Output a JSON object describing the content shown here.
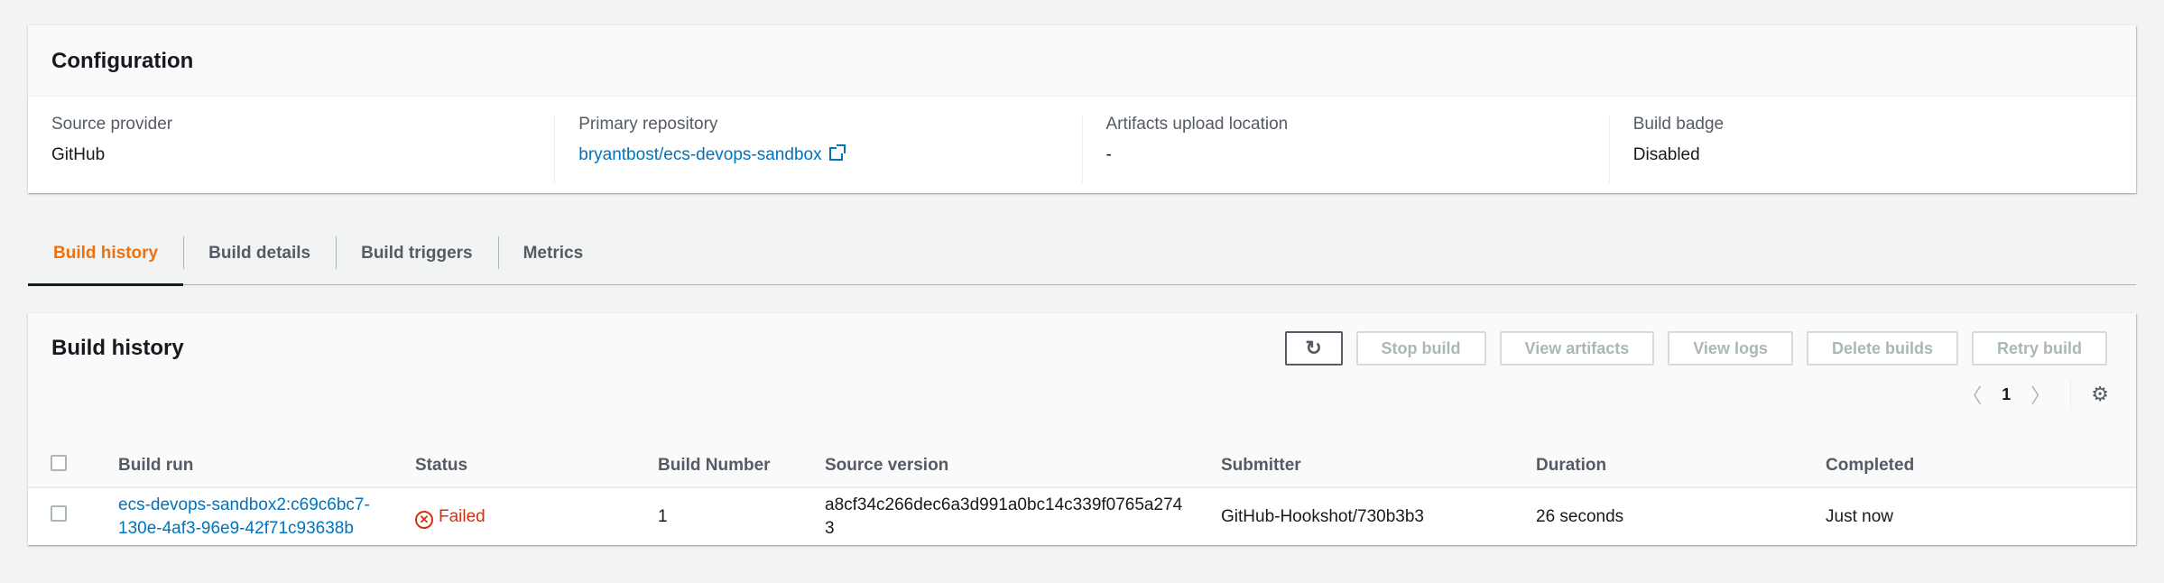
{
  "configuration": {
    "title": "Configuration",
    "fields": [
      {
        "label": "Source provider",
        "value": "GitHub"
      },
      {
        "label": "Primary repository",
        "value": "bryantbost/ecs-devops-sandbox"
      },
      {
        "label": "Artifacts upload location",
        "value": "-"
      },
      {
        "label": "Build badge",
        "value": "Disabled"
      }
    ]
  },
  "tabs": [
    "Build history",
    "Build details",
    "Build triggers",
    "Metrics"
  ],
  "build_history": {
    "title": "Build history",
    "buttons": {
      "stop": "Stop build",
      "artifacts": "View artifacts",
      "logs": "View logs",
      "delete": "Delete builds",
      "retry": "Retry build"
    },
    "page": "1",
    "columns": [
      "Build run",
      "Status",
      "Build Number",
      "Source version",
      "Submitter",
      "Duration",
      "Completed"
    ],
    "rows": [
      {
        "build_run": "ecs-devops-sandbox2:c69c6bc7-130e-4af3-96e9-42f71c93638b",
        "status": "Failed",
        "build_number": "1",
        "source_version": "a8cf34c266dec6a3d991a0bc14c339f0765a2743",
        "submitter": "GitHub-Hookshot/730b3b3",
        "duration": "26 seconds",
        "completed": "Just now"
      }
    ]
  },
  "colors": {
    "accent": "#ec7211",
    "link": "#0073bb",
    "error": "#d13212"
  }
}
